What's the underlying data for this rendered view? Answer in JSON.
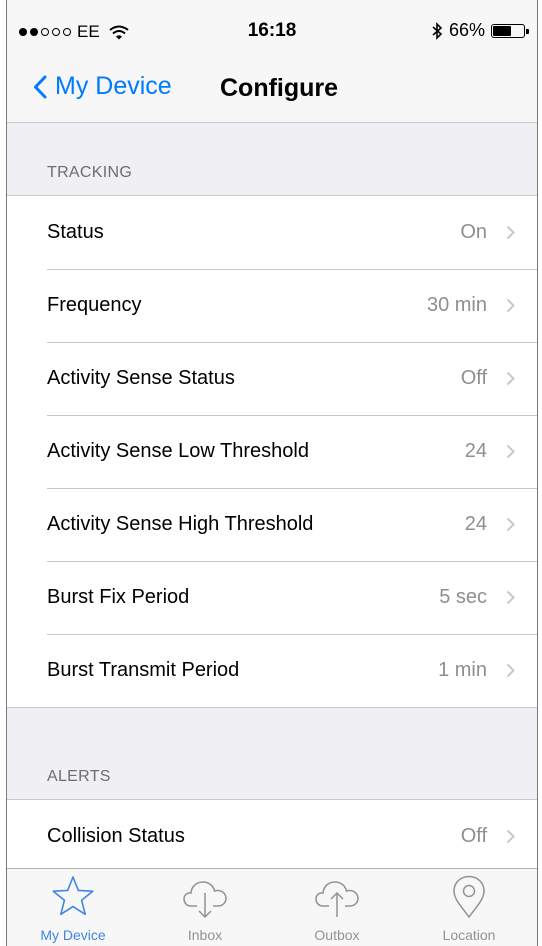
{
  "status_bar": {
    "carrier": "EE",
    "signal_filled": 2,
    "signal_total": 5,
    "time": "16:18",
    "bluetooth_icon": "bluetooth-icon",
    "battery_percent_text": "66%",
    "battery_level": 0.66
  },
  "nav": {
    "back_label": "My Device",
    "title": "Configure"
  },
  "sections": [
    {
      "header": "TRACKING",
      "rows": [
        {
          "label": "Status",
          "value": "On"
        },
        {
          "label": "Frequency",
          "value": "30 min"
        },
        {
          "label": "Activity Sense Status",
          "value": "Off"
        },
        {
          "label": "Activity Sense Low Threshold",
          "value": "24"
        },
        {
          "label": "Activity Sense High Threshold",
          "value": "24"
        },
        {
          "label": "Burst Fix Period",
          "value": "5 sec"
        },
        {
          "label": "Burst Transmit Period",
          "value": "1 min"
        }
      ]
    },
    {
      "header": "ALERTS",
      "rows": [
        {
          "label": "Collision Status",
          "value": "Off"
        }
      ]
    }
  ],
  "tabs": [
    {
      "label": "My Device",
      "icon": "star-icon",
      "active": true
    },
    {
      "label": "Inbox",
      "icon": "cloud-download-icon",
      "active": false
    },
    {
      "label": "Outbox",
      "icon": "cloud-upload-icon",
      "active": false
    },
    {
      "label": "Location",
      "icon": "location-pin-icon",
      "active": false
    }
  ],
  "colors": {
    "accent": "#007aff",
    "tab_active": "#3f86e4",
    "tab_inactive": "#929292",
    "secondary_text": "#8e8e93",
    "grouped_background": "#efeff4"
  }
}
